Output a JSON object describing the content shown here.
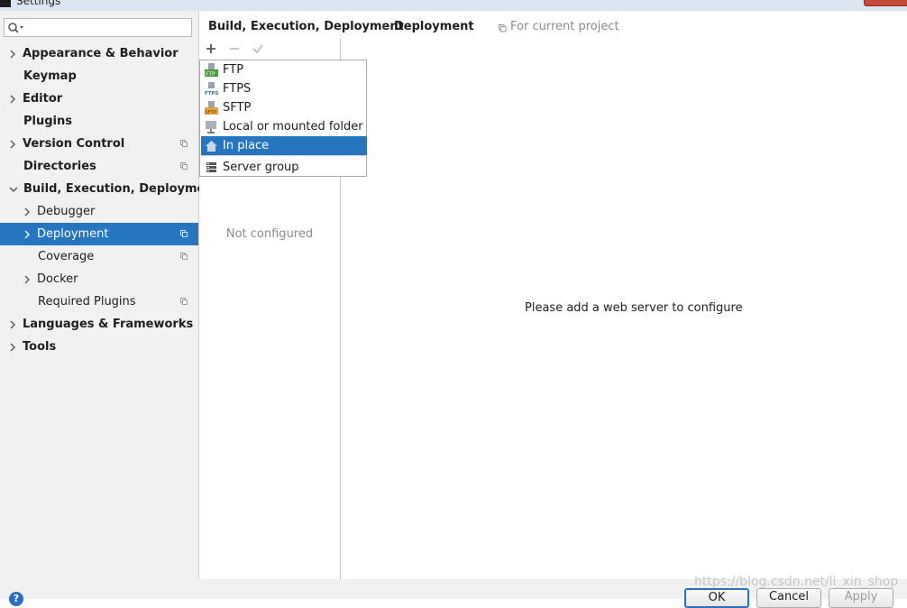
{
  "window": {
    "title": "Settings"
  },
  "search": {
    "placeholder": ""
  },
  "sidebar": {
    "items": [
      {
        "label": "Appearance & Behavior",
        "bold": true,
        "expandable": true
      },
      {
        "label": "Keymap",
        "bold": true,
        "expandable": false
      },
      {
        "label": "Editor",
        "bold": true,
        "expandable": true
      },
      {
        "label": "Plugins",
        "bold": true,
        "expandable": false
      },
      {
        "label": "Version Control",
        "bold": true,
        "expandable": true,
        "project_icon": true
      },
      {
        "label": "Directories",
        "bold": true,
        "expandable": false,
        "project_icon": true
      },
      {
        "label": "Build, Execution, Deployment",
        "bold": true,
        "expanded": true
      },
      {
        "label": "Debugger",
        "expandable": true
      },
      {
        "label": "Deployment",
        "expandable": true,
        "selected": true,
        "project_icon": true
      },
      {
        "label": "Coverage",
        "expandable": false,
        "project_icon": true
      },
      {
        "label": "Docker",
        "expandable": true
      },
      {
        "label": "Required Plugins",
        "expandable": false,
        "project_icon": true
      },
      {
        "label": "Languages & Frameworks",
        "bold": true,
        "expandable": true
      },
      {
        "label": "Tools",
        "bold": true,
        "expandable": true
      }
    ]
  },
  "breadcrumb": {
    "parent": "Build, Execution, Deployment",
    "separator": "›",
    "current": "Deployment",
    "scope": "For current project"
  },
  "servers": {
    "empty_text": "Not configured"
  },
  "content": {
    "message": "Please add a web server to configure"
  },
  "popup_menu": {
    "items": [
      {
        "label": "FTP",
        "icon": "ftp-icon"
      },
      {
        "label": "FTPS",
        "icon": "ftps-icon"
      },
      {
        "label": "SFTP",
        "icon": "sftp-icon"
      },
      {
        "label": "Local or mounted folder",
        "icon": "folder-icon"
      },
      {
        "label": "In place",
        "icon": "home-icon",
        "selected": true
      },
      {
        "label": "Server group",
        "icon": "server-group-icon"
      }
    ]
  },
  "buttons": {
    "ok": "OK",
    "cancel": "Cancel",
    "apply": "Apply",
    "help": "?"
  },
  "watermark": "https://blog.csdn.net/li_xin_shop",
  "colors": {
    "selection": "#2675bf",
    "sidebar_bg": "#f1f1f1",
    "muted_text": "#8c8c8c"
  }
}
